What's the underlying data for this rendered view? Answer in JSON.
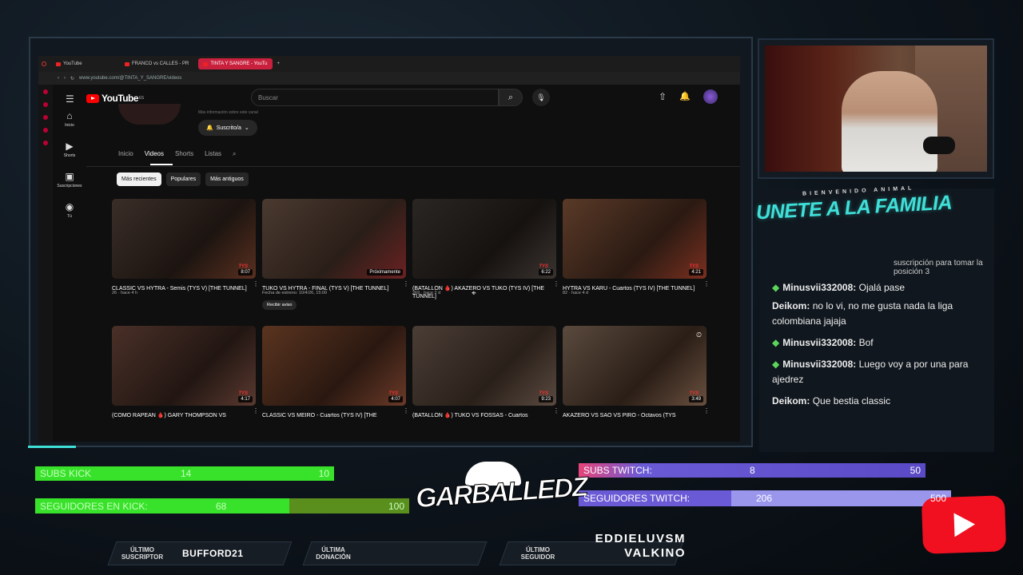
{
  "browser": {
    "tabs": [
      {
        "label": "YouTube"
      },
      {
        "label": "FRANCO vs CALLES - PR"
      },
      {
        "label": "TINTA Y SANGRE - YouTu"
      }
    ],
    "url": "www.youtube.com/@TINTA_Y_SANGRE/videos"
  },
  "youtube": {
    "region": "ES",
    "search_placeholder": "Buscar",
    "channel_info": "Más información sobre este canal",
    "subscribe_label": "Suscrito/a",
    "nav": [
      {
        "label": "Inicio",
        "icon": "home-icon"
      },
      {
        "label": "Shorts",
        "icon": "shorts-icon"
      },
      {
        "label": "Suscripciones",
        "icon": "subscriptions-icon"
      },
      {
        "label": "Tú",
        "icon": "you-icon"
      }
    ],
    "channel_tabs": [
      "Inicio",
      "Videos",
      "Shorts",
      "Listas"
    ],
    "active_tab": "Videos",
    "chips": [
      "Más recientes",
      "Populares",
      "Más antiguos"
    ],
    "active_chip": "Más recientes",
    "videos": [
      {
        "title": "CLASSIC VS HYTRA - Semis (TYS V) [THE TUNNEL]",
        "meta": "26 · hace 4 h",
        "duration": "8:07"
      },
      {
        "title": "TUKO VS HYTRA - FINAL (TYS V) [THE TUNNEL]",
        "meta": "Fecha de estreno: 10/4/26, 15:00",
        "duration": "Próximamente",
        "button": "Recibir aviso"
      },
      {
        "title": "(BATALLÓN 🩸) AKAZERO VS TUKO (TYS IV) [THE TUNNEL]",
        "meta": "269 · hace 2 d",
        "duration": "6:22"
      },
      {
        "title": "HYTRA VS KARU - Cuartos (TYS IV) [THE TUNNEL]",
        "meta": "82 · hace 4 d",
        "duration": "4:21"
      },
      {
        "title": "(COMO RAPEAN 🩸) GARY THOMPSON VS",
        "meta": "",
        "duration": "4:17"
      },
      {
        "title": "CLASSIC VS MEIRO - Cuartos (TYS IV) [THE",
        "meta": "",
        "duration": "4:07"
      },
      {
        "title": "(BATALLÓN 🩸) TUKO VS FOSSAS - Cuartos",
        "meta": "",
        "duration": "9:23"
      },
      {
        "title": "AKAZERO VS SAO VS PIRO - Octavos (TYS",
        "meta": "",
        "duration": "3:49"
      }
    ],
    "thumb_badge": "TYS"
  },
  "chat": {
    "welcome": "BIENVENIDO ANIMAL",
    "headline": "UNETE A LA FAMILIA",
    "goal_text": "suscripción para tomar la posición 3",
    "messages": [
      {
        "user": "Minusvii332008:",
        "text": "Ojalá pase",
        "badge": true
      },
      {
        "user": "Deikom:",
        "text": "no lo vi, no me gusta nada la liga colombiana jajaja",
        "badge": false
      },
      {
        "user": "Minusvii332008:",
        "text": "Bof",
        "badge": true
      },
      {
        "user": "Minusvii332008:",
        "text": "Luego voy a por una para ajedrez",
        "badge": true
      },
      {
        "user": "Deikom:",
        "text": "Que bestia classic",
        "badge": false
      }
    ]
  },
  "bars": {
    "kick_subs": {
      "label": "SUBS KICK",
      "current": "14",
      "goal": "10",
      "progress": 1.0
    },
    "kick_followers": {
      "label": "SEGUIDORES EN KICK:",
      "current": "68",
      "goal": "100",
      "progress": 0.68
    },
    "twitch_subs": {
      "label": "SUBS TWITCH:",
      "current": "8",
      "goal": "50",
      "progress": 0.16
    },
    "twitch_followers": {
      "label": "SEGUIDORES TWITCH:",
      "current": "206",
      "goal": "500",
      "progress": 0.41
    }
  },
  "brand": {
    "name": "GARBALLEDZ"
  },
  "bottom": {
    "last_sub_label": "ÚLTIMO SUSCRIPTOR",
    "last_sub_value": "BUFFORD21",
    "last_donation_label": "ÚLTIMA DONACIÓN",
    "last_donation_value": "",
    "last_follower_label": "ÚLTIMO SEGUIDOR",
    "last_follower_values": [
      "EDDIELUVSM",
      "VALKINO"
    ]
  },
  "colors": {
    "accent": "#3fe0d8",
    "kick": "#39e22a",
    "twitch": "#6a5ad6",
    "youtube_red": "#ff0000"
  }
}
